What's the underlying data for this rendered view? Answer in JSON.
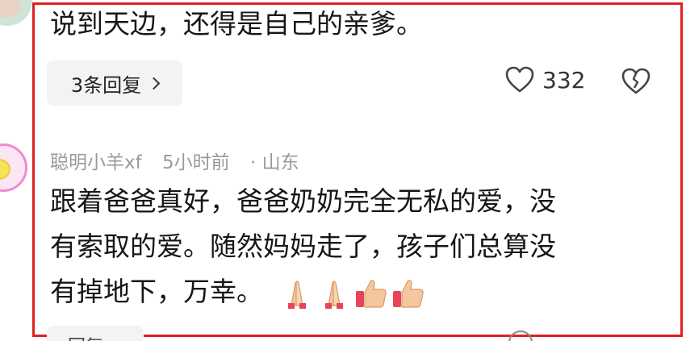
{
  "comment1": {
    "text": "说到天边，还得是自己的亲爹。",
    "replies_label": "3条回复",
    "like_count": "332"
  },
  "comment2": {
    "username": "聪明小羊xf",
    "time": "5小时前",
    "location": "· 山东",
    "lines": [
      "跟着爸爸真好，爸爸奶奶完全无私的爱，没",
      "有索取的爱。随然妈妈走了，孩子们总算没",
      "有掉地下，万幸。"
    ],
    "emojis": [
      "praying-hands-icon",
      "praying-hands-icon",
      "thumbs-up-icon",
      "thumbs-up-icon"
    ]
  },
  "next_row": {
    "chip_text": "回复"
  },
  "colors": {
    "highlight": "#e02020",
    "meta": "#9a9a9a",
    "chip_bg": "#f3f3f3"
  }
}
